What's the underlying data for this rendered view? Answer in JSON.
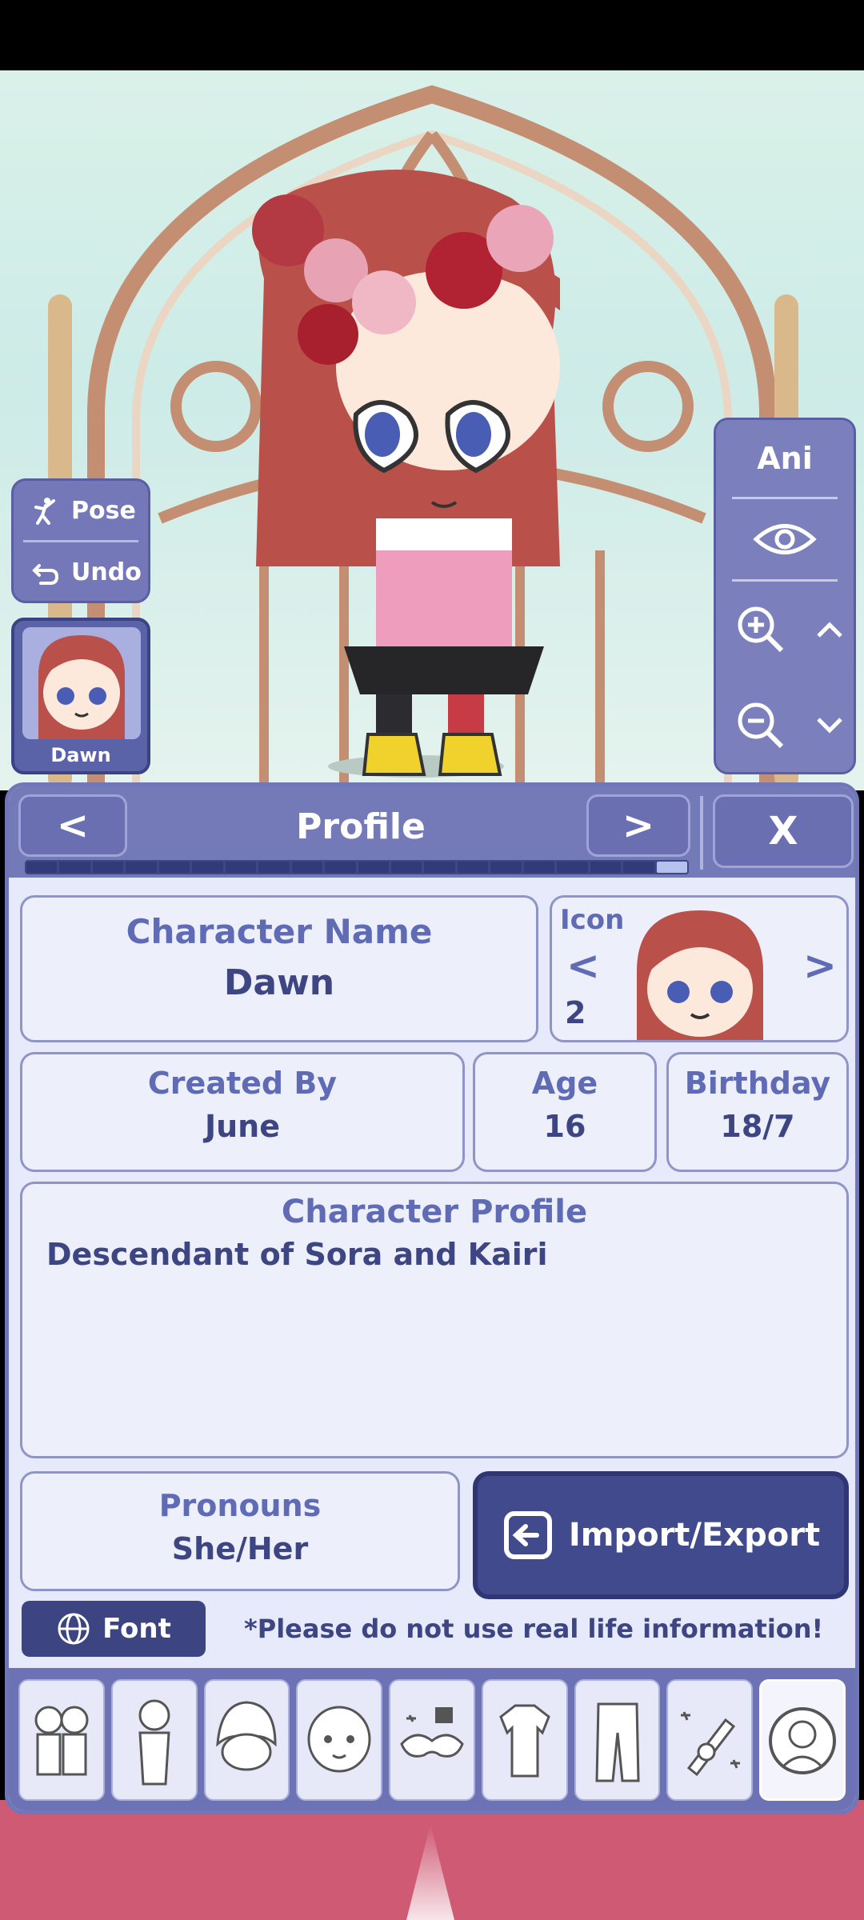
{
  "left_tools": {
    "pose_label": "Pose",
    "undo_label": "Undo"
  },
  "character_card": {
    "name": "Dawn"
  },
  "right_tools": {
    "ani_label": "Ani"
  },
  "panel": {
    "title": "Profile",
    "prev_label": "<",
    "next_label": ">",
    "close_label": "X",
    "progress": {
      "segments_total": 20,
      "current_segment": 20
    },
    "character_name": {
      "label": "Character Name",
      "value": "Dawn"
    },
    "icon": {
      "label": "Icon",
      "index": "2",
      "prev": "<",
      "next": ">"
    },
    "created_by": {
      "label": "Created By",
      "value": "June"
    },
    "age": {
      "label": "Age",
      "value": "16"
    },
    "birthday": {
      "label": "Birthday",
      "value": "18/7"
    },
    "profile": {
      "label": "Character Profile",
      "value": "Descendant of Sora and Kairi"
    },
    "pronouns": {
      "label": "Pronouns",
      "value": "She/Her"
    },
    "import_export_label": "Import/Export",
    "font_label": "Font",
    "note": "*Please do not use real life information!"
  },
  "tabs": [
    {
      "icon": "group-characters-icon"
    },
    {
      "icon": "body-icon"
    },
    {
      "icon": "hair-icon"
    },
    {
      "icon": "face-icon"
    },
    {
      "icon": "accessory-mask-icon"
    },
    {
      "icon": "top-clothing-icon"
    },
    {
      "icon": "bottom-clothing-icon"
    },
    {
      "icon": "weapon-icon"
    },
    {
      "icon": "profile-icon"
    }
  ],
  "colors": {
    "panel": "#e7eafa",
    "header": "#7479b8",
    "accent": "#414a8d",
    "text": "#3d4582"
  }
}
